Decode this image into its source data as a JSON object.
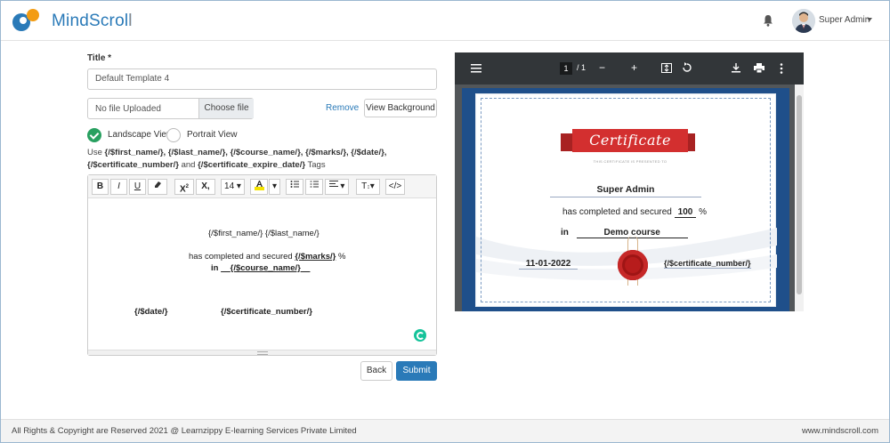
{
  "header": {
    "brand": "MindScroll",
    "user_name": "Super Admin"
  },
  "form": {
    "title_label": "Title *",
    "title_value": "Default Template 4",
    "file_text": "No file Uploaded",
    "choose_label": "Choose file",
    "remove_label": "Remove",
    "view_bg_label": "View Background",
    "landscape_label": "Landscape View",
    "portrait_label": "Portrait View",
    "orientation_selected": "Landscape View",
    "tags_use": "Use",
    "tags_first": "{/$first_name/},",
    "tags_last": "{/$last_name/},",
    "tags_course": "{/$course_name/},",
    "tags_marks": "{/$marks/},",
    "tags_date": "{/$date/},",
    "tags_certnum": "{/$certificate_number/}",
    "tags_and": "and",
    "tags_expire": "{/$certificate_expire_date/}",
    "tags_tail": "Tags",
    "back_label": "Back",
    "submit_label": "Submit"
  },
  "toolbar": {
    "bold": "B",
    "italic": "I",
    "underline": "U",
    "superscript": "X",
    "subscript": "X,",
    "font_size": "14",
    "code": "</>",
    "text_style": "T"
  },
  "editor": {
    "line1": "{/$first_name/} {/$last_name/}",
    "line2_pre": "has completed and secured",
    "line2_tag": "{/$marks/}",
    "line2_post": "%",
    "line3_pre": "in",
    "line3_tag": "{/$course_name/}",
    "date_tag": "{/$date/}",
    "certnum_tag": "{/$certificate_number/}"
  },
  "pdf": {
    "page_current": "1",
    "page_total": "/ 1"
  },
  "certificate": {
    "ribbon_title": "Certificate",
    "small_caption": "THIS CERTIFICATE IS PRESENTED TO",
    "name": "Super  Admin",
    "completed_pre": "has completed and secured",
    "marks": "100",
    "percent": "%",
    "in_label": "in",
    "course": "Demo course",
    "date": "11-01-2022",
    "certnum": "{/$certificate_number/}"
  },
  "footer": {
    "copyright": "All Rights & Copyright are Reserved 2021 @ Learnzippy E-learning Services Private Limited",
    "site": "www.mindscroll.com"
  },
  "colors": {
    "brand": "#2a7ab8",
    "accent_green": "#28a060",
    "certificate_frame": "#1f4f8a",
    "ribbon": "#d32f2f"
  }
}
